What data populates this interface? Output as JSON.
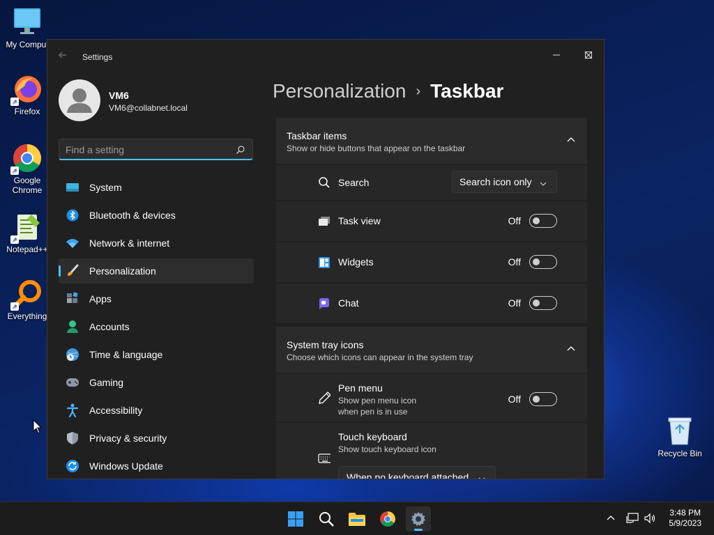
{
  "desktop": {
    "icons": [
      {
        "label": "My Comput",
        "icon": "computer-icon"
      },
      {
        "label": "Firefox",
        "icon": "firefox-icon"
      },
      {
        "label": "Google Chrome",
        "icon": "chrome-icon"
      },
      {
        "label": "Notepad++",
        "icon": "notepad-plus-plus-icon"
      },
      {
        "label": "Everything",
        "icon": "everything-search-icon"
      }
    ],
    "recycle_bin": "Recycle Bin"
  },
  "window": {
    "title": "Settings",
    "controls": [
      "minimize",
      "maximize",
      "close"
    ]
  },
  "profile": {
    "name": "VM6",
    "email": "VM6@collabnet.local"
  },
  "search": {
    "placeholder": "Find a setting",
    "value": ""
  },
  "sidebar": {
    "items": [
      {
        "label": "System",
        "icon": "system-icon"
      },
      {
        "label": "Bluetooth & devices",
        "icon": "bluetooth-icon"
      },
      {
        "label": "Network & internet",
        "icon": "wifi-icon"
      },
      {
        "label": "Personalization",
        "icon": "brush-icon",
        "active": true
      },
      {
        "label": "Apps",
        "icon": "apps-icon"
      },
      {
        "label": "Accounts",
        "icon": "person-icon"
      },
      {
        "label": "Time & language",
        "icon": "globe-clock-icon"
      },
      {
        "label": "Gaming",
        "icon": "gamepad-icon"
      },
      {
        "label": "Accessibility",
        "icon": "accessibility-icon"
      },
      {
        "label": "Privacy & security",
        "icon": "shield-icon"
      },
      {
        "label": "Windows Update",
        "icon": "update-icon"
      }
    ]
  },
  "breadcrumb": {
    "parent": "Personalization",
    "separator": "›",
    "current": "Taskbar"
  },
  "taskbar_items": {
    "title": "Taskbar items",
    "subtitle": "Show or hide buttons that appear on the taskbar",
    "rows": {
      "search": {
        "label": "Search",
        "value": "Search icon only"
      },
      "task_view": {
        "label": "Task view",
        "state": "Off"
      },
      "widgets": {
        "label": "Widgets",
        "state": "Off"
      },
      "chat": {
        "label": "Chat",
        "state": "Off"
      }
    }
  },
  "system_tray": {
    "title": "System tray icons",
    "subtitle": "Choose which icons can appear in the system tray",
    "rows": {
      "pen_menu": {
        "label": "Pen menu",
        "sub1": "Show pen menu icon",
        "sub2": "when pen is in use",
        "state": "Off"
      },
      "touch_keyboard": {
        "label": "Touch keyboard",
        "sub1": "Show touch keyboard icon",
        "value": "When no keyboard attached"
      }
    }
  },
  "system_taskbar": {
    "apps": [
      "start-icon",
      "search-icon",
      "file-explorer-icon",
      "chrome-icon",
      "settings-icon"
    ],
    "time": "3:48 PM",
    "date": "5/9/2023"
  },
  "colors": {
    "accent": "#4cc2ff",
    "window_bg": "#202020",
    "card_bg": "#2b2b2b"
  }
}
